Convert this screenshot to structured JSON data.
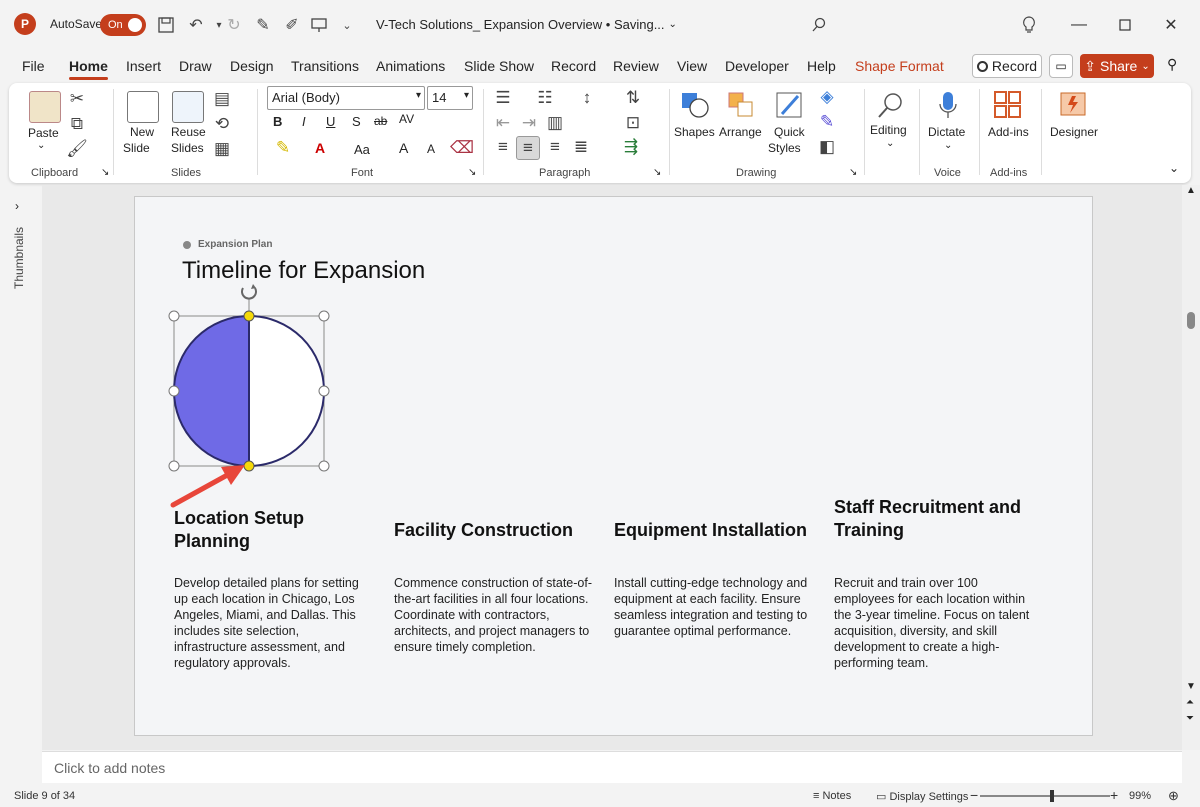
{
  "titlebar": {
    "app_logo": "P",
    "autosave_label": "AutoSave",
    "autosave_state": "On",
    "doc_title": "V-Tech Solutions_ Expansion Overview • Saving...",
    "icons": [
      "save-icon",
      "undo-icon",
      "redo-icon",
      "pen-icon",
      "draw-icon",
      "present-icon",
      "customize-icon",
      "search-icon",
      "lightbulb-icon",
      "minimize-icon",
      "maximize-icon",
      "close-icon"
    ]
  },
  "tabs": [
    "File",
    "Home",
    "Insert",
    "Draw",
    "Design",
    "Transitions",
    "Animations",
    "Slide Show",
    "Record",
    "Review",
    "View",
    "Developer",
    "Help",
    "Shape Format"
  ],
  "active_tab": "Home",
  "header_buttons": {
    "record": "Record",
    "share": "Share"
  },
  "ribbon": {
    "clipboard": {
      "paste": "Paste",
      "label": "Clipboard"
    },
    "slides": {
      "new_slide": "New",
      "new_slide2": "Slide",
      "reuse": "Reuse",
      "reuse2": "Slides",
      "label": "Slides"
    },
    "font": {
      "font_name": "Arial (Body)",
      "font_size": "14",
      "label": "Font",
      "bold": "B",
      "italic": "I",
      "underline": "U",
      "shadow": "S",
      "strike": "ab",
      "spacing": "AV",
      "case": "Aa",
      "grow": "A",
      "shrink": "A"
    },
    "paragraph": {
      "label": "Paragraph"
    },
    "drawing": {
      "shapes": "Shapes",
      "arrange": "Arrange",
      "quick_styles": "Quick",
      "quick_styles2": "Styles",
      "label": "Drawing"
    },
    "editing": {
      "label_btn": "Editing"
    },
    "voice": {
      "dictate": "Dictate",
      "label": "Voice"
    },
    "addins": {
      "btn": "Add-ins",
      "label": "Add-ins"
    },
    "designer": {
      "btn": "Designer"
    }
  },
  "left_pane": {
    "thumbnails": "Thumbnails"
  },
  "slide": {
    "tag": "Expansion Plan",
    "title": "Timeline for Expansion",
    "columns": [
      {
        "heading": "Location Setup Planning",
        "body": "Develop detailed plans for setting up each location in Chicago, Los Angeles, Miami, and Dallas. This includes site selection, infrastructure assessment, and regulatory approvals."
      },
      {
        "heading": "Facility Construction",
        "body": "Commence construction of state-of-the-art facilities in all four locations. Coordinate with contractors, architects, and project managers to ensure timely completion."
      },
      {
        "heading": "Equipment Installation",
        "body": "Install cutting-edge technology and equipment at each facility. Ensure seamless integration and testing to guarantee optimal performance."
      },
      {
        "heading": "Staff Recruitment and Training",
        "body": "Recruit and train over 100 employees for each location within the 3-year timeline. Focus on talent acquisition, diversity, and skill development to create a high-performing team."
      }
    ],
    "shape": {
      "fill": "#6f6ae6",
      "stroke": "#2b2a6a",
      "handle_fill": "#f5d90a"
    }
  },
  "notes": {
    "placeholder": "Click to add notes"
  },
  "status": {
    "slide_info": "Slide 9 of 34",
    "notes_btn": "Notes",
    "display_settings": "Display Settings",
    "zoom": "99%"
  },
  "colors": {
    "accent": "#c43e1c",
    "arrow": "#e8463a"
  }
}
